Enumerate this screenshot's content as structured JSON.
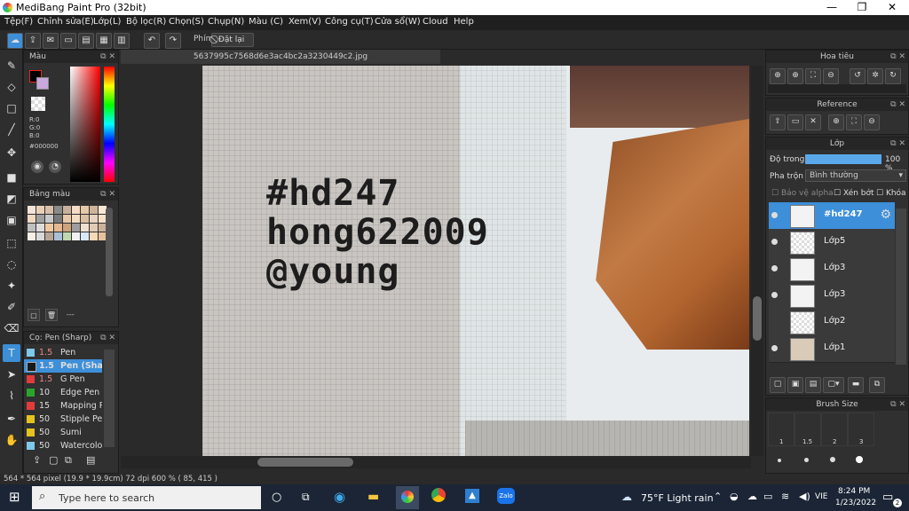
{
  "window": {
    "title": "MediBang Paint Pro (32bit)",
    "min": "—",
    "max": "❐",
    "close": "✕"
  },
  "menu": [
    "Tệp(F)",
    "Chỉnh sửa(E)",
    "Lớp(L)",
    "Bộ lọc(R)",
    "Chọn(S)",
    "Chụp(N)",
    "Màu (C)",
    "Xem(V)",
    "Công cụ(T)",
    "Cửa sổ(W)",
    "Cloud",
    "Help"
  ],
  "toolbar": {
    "shortcut_label": "Phím",
    "reset_label": "Đặt lại"
  },
  "document": {
    "tab_title": "5637995c7568d6e3ac4bc2a3230449c2.jpg"
  },
  "canvas_text": [
    "#hd247",
    "hong622009",
    "@young"
  ],
  "color_panel": {
    "title": "Màu",
    "r": "R:0",
    "g": "G:0",
    "b": "B:0",
    "hex": "#000000"
  },
  "palette_panel": {
    "title": "Bảng màu",
    "footer": "---"
  },
  "brush_panel": {
    "title": "Cọ: Pen (Sharp)",
    "items": [
      {
        "size": "1.5",
        "name": "Pen",
        "color": "#7ec8ea"
      },
      {
        "size": "1.5",
        "name": "Pen (Sharp)",
        "color": "#1a1a1a"
      },
      {
        "size": "1.5",
        "name": "G Pen",
        "color": "#e23b3b"
      },
      {
        "size": "10",
        "name": "Edge Pen",
        "color": "#2aa52a"
      },
      {
        "size": "15",
        "name": "Mapping Pen",
        "color": "#e23b3b"
      },
      {
        "size": "50",
        "name": "Stipple Pen",
        "color": "#e6c21e"
      },
      {
        "size": "50",
        "name": "Sumi",
        "color": "#e6c21e"
      },
      {
        "size": "50",
        "name": "Watercolor",
        "color": "#7ec8ea"
      }
    ]
  },
  "navigator": {
    "title": "Hoa tiêu"
  },
  "reference": {
    "title": "Reference"
  },
  "layers_panel": {
    "title": "Lớp",
    "opacity_label": "Độ trong",
    "opacity_value": "100 %",
    "blend_label": "Pha trộn",
    "blend_value": "Bình thường",
    "protect_alpha": "Bảo vệ alpha",
    "clipping": "Xén bớt",
    "lock": "Khóa",
    "layers": [
      "#hd247",
      "Lớp5",
      "Lớp3",
      "Lớp3",
      "Lớp2",
      "Lớp1"
    ]
  },
  "brush_size": {
    "title": "Brush Size",
    "labels": [
      "1",
      "1.5",
      "2",
      "3"
    ]
  },
  "status": {
    "text": "564 * 564 pixel  (19.9 * 19.9cm)  72 dpi  600 %  ( 85, 415 )"
  },
  "taskbar": {
    "search_placeholder": "Type here to search",
    "weather": "75°F  Light rain",
    "lang": "VIE",
    "time": "8:24 PM",
    "date": "1/23/2022",
    "zalo": "Zalo",
    "notif_count": "2"
  },
  "colors": {
    "accent": "#3d8fd9",
    "panel": "#303030",
    "taskbar": "#1b2535"
  }
}
